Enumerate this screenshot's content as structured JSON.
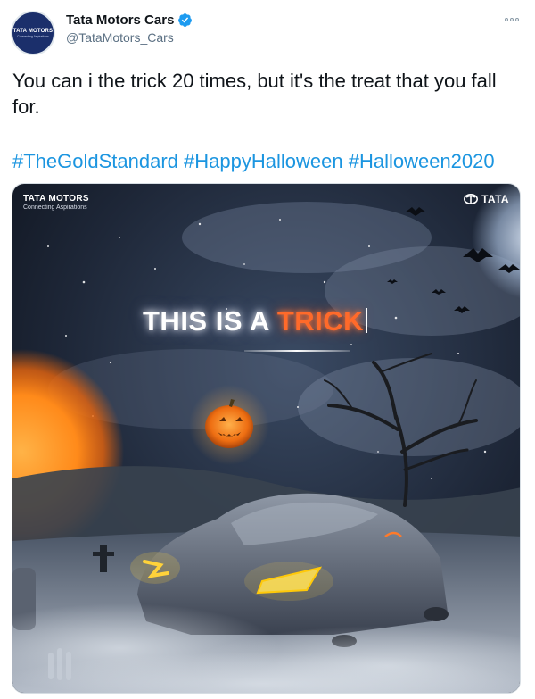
{
  "tweet": {
    "author": {
      "display_name": "Tata Motors Cars",
      "handle": "@TataMotors_Cars",
      "avatar_brand": "TATA MOTORS",
      "avatar_tagline": "Connecting Aspirations",
      "verified": true
    },
    "text": "You can i the trick 20 times, but it's the treat that you fall for.",
    "hashtags": [
      "#TheGoldStandard",
      "#HappyHalloween",
      "#Halloween2020"
    ],
    "more_icon": "more-options-icon"
  },
  "media": {
    "brand_left_name": "TATA MOTORS",
    "brand_left_tagline": "Connecting Aspirations",
    "brand_right_name": "TATA",
    "headline_white": "THIS IS A ",
    "headline_orange": "TRICK",
    "colors": {
      "headline_accent": "#ff6a2a",
      "sky": "#1a2233",
      "hashtag_link": "#1b95e0"
    }
  }
}
